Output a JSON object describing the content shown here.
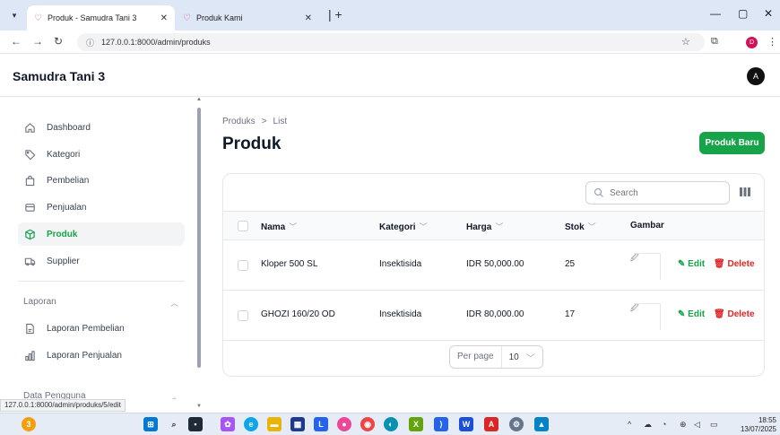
{
  "browser": {
    "tabs": [
      {
        "title": "Produk - Samudra Tani 3",
        "active": true
      },
      {
        "title": "Produk Kami",
        "active": false
      }
    ],
    "url": "127.0.0.1:8000/admin/produks",
    "profile_initial": "D",
    "status_url": "127.0.0.1:8000/admin/produks/5/edit"
  },
  "header": {
    "brand": "Samudra Tani 3",
    "avatar_initial": "A"
  },
  "sidebar": {
    "items": [
      {
        "label": "Dashboard",
        "icon": "home-icon"
      },
      {
        "label": "Kategori",
        "icon": "tag-icon"
      },
      {
        "label": "Pembelian",
        "icon": "shopping-bag-icon"
      },
      {
        "label": "Penjualan",
        "icon": "inbox-icon"
      },
      {
        "label": "Produk",
        "icon": "cube-icon",
        "active": true
      },
      {
        "label": "Supplier",
        "icon": "truck-icon"
      }
    ],
    "groups": [
      {
        "label": "Laporan",
        "items": [
          {
            "label": "Laporan Pembelian",
            "icon": "document-icon"
          },
          {
            "label": "Laporan Penjualan",
            "icon": "chart-bar-icon"
          }
        ]
      },
      {
        "label": "Data Pengguna"
      }
    ]
  },
  "page": {
    "breadcrumb": [
      "Produks",
      "List"
    ],
    "title": "Produk",
    "new_button": "Produk Baru"
  },
  "table": {
    "search_placeholder": "Search",
    "columns": [
      "Nama",
      "Kategori",
      "Harga",
      "Stok",
      "Gambar"
    ],
    "rows": [
      {
        "nama": "Kloper 500 SL",
        "kategori": "Insektisida",
        "harga": "IDR 50,000.00",
        "stok": "25"
      },
      {
        "nama": "GHOZI 160/20 OD",
        "kategori": "Insektisida",
        "harga": "IDR 80,000.00",
        "stok": "17"
      }
    ],
    "edit_label": "Edit",
    "delete_label": "Delete",
    "per_page_label": "Per page",
    "per_page_value": "10"
  },
  "taskbar": {
    "time": "18:55",
    "date": "13/07/2025",
    "notification_count": "3"
  },
  "colors": {
    "primary": "#16a34a",
    "danger": "#dc2626"
  }
}
